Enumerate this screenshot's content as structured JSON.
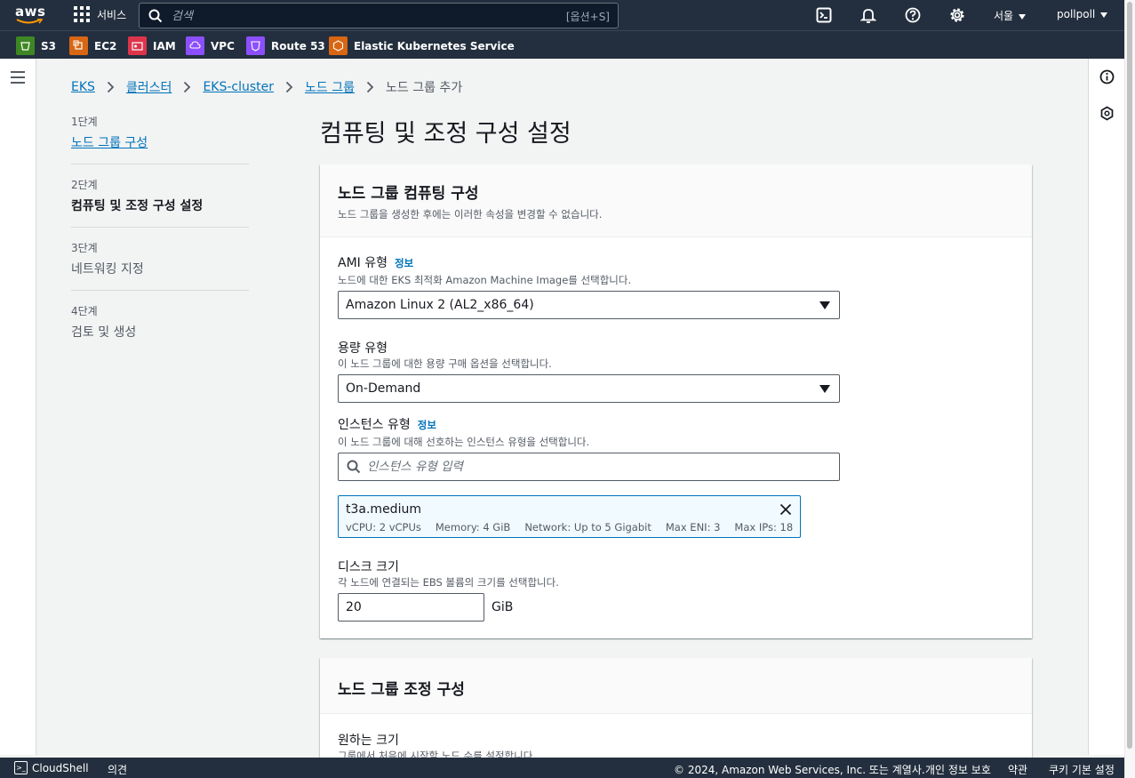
{
  "topnav": {
    "services_label": "서비스",
    "search_placeholder": "검색",
    "search_hint": "[옵션+S]",
    "region": "서울",
    "user": "pollpoll"
  },
  "favorites": [
    {
      "label": "S3",
      "color": "#3f8624"
    },
    {
      "label": "EC2",
      "color": "#d86613"
    },
    {
      "label": "IAM",
      "color": "#dd344c"
    },
    {
      "label": "VPC",
      "color": "#8c4fff"
    },
    {
      "label": "Route 53",
      "color": "#8c4fff"
    },
    {
      "label": "Elastic Kubernetes Service",
      "color": "#d86613"
    }
  ],
  "breadcrumb": {
    "items": [
      "EKS",
      "클러스터",
      "EKS-cluster",
      "노드 그룹"
    ],
    "current": "노드 그룹 추가"
  },
  "steps": [
    {
      "num": "1단계",
      "label": "노드 그룹 구성"
    },
    {
      "num": "2단계",
      "label": "컴퓨팅 및 조정 구성 설정"
    },
    {
      "num": "3단계",
      "label": "네트워킹 지정"
    },
    {
      "num": "4단계",
      "label": "검토 및 생성"
    }
  ],
  "page_title": "컴퓨팅 및 조정 구성 설정",
  "compute": {
    "title": "노드 그룹 컴퓨팅 구성",
    "description": "노드 그룹을 생성한 후에는 이러한 속성을 변경할 수 없습니다.",
    "ami": {
      "label": "AMI 유형",
      "info": "정보",
      "description": "노드에 대한 EKS 최적화 Amazon Machine Image를 선택합니다.",
      "value": "Amazon Linux 2 (AL2_x86_64)"
    },
    "capacity": {
      "label": "용량 유형",
      "description": "이 노드 그룹에 대한 용량 구매 옵션을 선택합니다.",
      "value": "On-Demand"
    },
    "instance": {
      "label": "인스턴스 유형",
      "info": "정보",
      "description": "이 노드 그룹에 대해 선호하는 인스턴스 유형을 선택합니다.",
      "placeholder": "인스턴스 유형 입력",
      "selected": {
        "name": "t3a.medium",
        "vcpu": "vCPU: 2 vCPUs",
        "memory": "Memory: 4 GiB",
        "network": "Network: Up to 5 Gigabit",
        "eni": "Max ENI: 3",
        "ips": "Max IPs: 18"
      }
    },
    "disk": {
      "label": "디스크 크기",
      "description": "각 노드에 연결되는 EBS 볼륨의 크기를 선택합니다.",
      "value": "20",
      "unit": "GiB"
    }
  },
  "scaling": {
    "title": "노드 그룹 조정 구성",
    "desired": {
      "label": "원하는 크기",
      "description": "그룹에서 처음에 시작할 노드 수를 설정합니다."
    }
  },
  "footer": {
    "cloudshell": "CloudShell",
    "feedback": "의견",
    "copyright": "© 2024, Amazon Web Services, Inc. 또는 계열사.",
    "privacy": "개인 정보 보호",
    "terms": "약관",
    "cookies": "쿠키 기본 설정"
  }
}
